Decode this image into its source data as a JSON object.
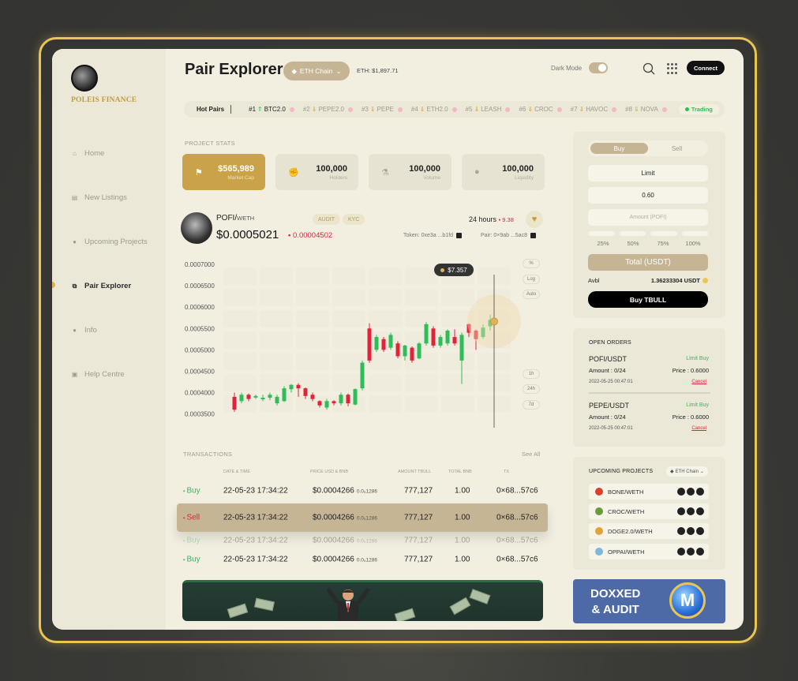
{
  "brand": {
    "name": "POLEIS FINANCE"
  },
  "sidebar": {
    "items": [
      {
        "label": "Home",
        "icon": "home-icon",
        "active": false
      },
      {
        "label": "New Listings",
        "icon": "list-icon",
        "active": false
      },
      {
        "label": "Upcoming Projects",
        "icon": "drop-icon",
        "active": false
      },
      {
        "label": "Pair Explorer",
        "icon": "pair-icon",
        "active": true
      },
      {
        "label": "Info",
        "icon": "info-icon",
        "active": false
      },
      {
        "label": "Help Centre",
        "icon": "help-icon",
        "active": false
      }
    ]
  },
  "header": {
    "title": "Pair Explorer",
    "chain": "ETH Chain",
    "eth_price": "ETH: $1,897.71",
    "dark_mode_label": "Dark Mode",
    "dark_mode_on": true,
    "connect_label": "Connect"
  },
  "hot_pairs": {
    "label": "Hot Pairs",
    "items": [
      {
        "rank": "#1",
        "name": "BTC2.0"
      },
      {
        "rank": "#2",
        "name": "PEPE2.0"
      },
      {
        "rank": "#3",
        "name": "PEPE"
      },
      {
        "rank": "#4",
        "name": "ETH2.0"
      },
      {
        "rank": "#5",
        "name": "LEASH"
      },
      {
        "rank": "#6",
        "name": "CROC"
      },
      {
        "rank": "#7",
        "name": "HAVOC"
      },
      {
        "rank": "#8",
        "name": "NOVA"
      }
    ],
    "status": "Trading"
  },
  "stats": {
    "section_label": "PROJECT STATS",
    "cards": [
      {
        "value": "$565,989",
        "label": "Market Cap",
        "icon": "flag-icon"
      },
      {
        "value": "100,000",
        "label": "Holders",
        "icon": "fist-icon"
      },
      {
        "value": "100,000",
        "label": "Volume",
        "icon": "flask-icon"
      },
      {
        "value": "100,000",
        "label": "Liquidity",
        "icon": "drop-icon"
      }
    ]
  },
  "token": {
    "pair": "POFI/",
    "pair_quote": "WETH",
    "price": "$0.0005021",
    "change": "0.00004502",
    "tags": [
      "AUDIT",
      "KYC"
    ],
    "period": "24 hours",
    "period_change": "9.38",
    "token_addr": "Token: 0xe3a ...b1fd",
    "pair_addr": "Pair: 0×9ab ...5ac8"
  },
  "chart_data": {
    "type": "candlestick",
    "y_ticks": [
      "0.0007000",
      "0.0006500",
      "0.0006000",
      "0.0005500",
      "0.0005000",
      "0.0004500",
      "0.0004000",
      "0.0003500"
    ],
    "ylim": [
      0.00034,
      0.0007
    ],
    "tooltip": "$7.357",
    "buttons_top": [
      "%",
      "Log",
      "Auto"
    ],
    "buttons_bottom": [
      "1h",
      "24h",
      "7d"
    ],
    "candles": [
      [
        0.00039,
        0.00036,
        0.0004,
        0.000355
      ],
      [
        0.00038,
        0.000395,
        0.0004,
        0.000375
      ],
      [
        0.000395,
        0.000385,
        0.000398,
        0.00038
      ],
      [
        0.00039,
        0.000392,
        0.000395,
        0.000385
      ],
      [
        0.000385,
        0.000388,
        0.000395,
        0.00038
      ],
      [
        0.000388,
        0.000395,
        0.0004,
        0.000382
      ],
      [
        0.000375,
        0.00039,
        0.000395,
        0.00037
      ],
      [
        0.00038,
        0.00041,
        0.000415,
        0.000378
      ],
      [
        0.000408,
        0.000418,
        0.00042,
        0.0004
      ],
      [
        0.000418,
        0.00041,
        0.000422,
        0.00039
      ],
      [
        0.00041,
        0.000392,
        0.000412,
        0.000385
      ],
      [
        0.000395,
        0.000385,
        0.0004,
        0.00038
      ],
      [
        0.00038,
        0.00037,
        0.000382,
        0.000365
      ],
      [
        0.000365,
        0.00038,
        0.000385,
        0.00036
      ],
      [
        0.00038,
        0.000375,
        0.000382,
        0.00037
      ],
      [
        0.000375,
        0.000395,
        0.0004,
        0.00037
      ],
      [
        0.000395,
        0.000375,
        0.000398,
        0.000368
      ],
      [
        0.000372,
        0.000408,
        0.00041,
        0.00037
      ],
      [
        0.00041,
        0.00047,
        0.000475,
        0.000405
      ],
      [
        0.00055,
        0.000475,
        0.000562,
        0.00047
      ],
      [
        0.0005,
        0.00053,
        0.000535,
        0.000495
      ],
      [
        0.000525,
        0.0005,
        0.00053,
        0.000495
      ],
      [
        0.000505,
        0.000535,
        0.00054,
        0.0005
      ],
      [
        0.000515,
        0.000485,
        0.00052,
        0.00048
      ],
      [
        0.000485,
        0.00051,
        0.000512,
        0.000475
      ],
      [
        0.000505,
        0.000475,
        0.000508,
        0.00047
      ],
      [
        0.00048,
        0.000515,
        0.000518,
        0.000478
      ],
      [
        0.000515,
        0.00056,
        0.000565,
        0.00051
      ],
      [
        0.00055,
        0.00051,
        0.000555,
        0.000505
      ],
      [
        0.00051,
        0.00053,
        0.000535,
        0.000505
      ],
      [
        0.000515,
        0.000545,
        0.000548,
        0.00051
      ],
      [
        0.00053,
        0.000515,
        0.000548,
        0.00051
      ],
      [
        0.000475,
        0.000535,
        0.00054,
        0.00042
      ],
      [
        0.00056,
        0.00054,
        0.000562,
        0.00053
      ],
      [
        0.000545,
        0.000525,
        0.000548,
        0.0005
      ],
      [
        0.00053,
        0.000552,
        0.00056,
        0.000525
      ],
      [
        0.000555,
        0.00057,
        0.000582,
        0.000545
      ]
    ]
  },
  "transactions": {
    "label": "TRANSACTIONS",
    "see_all": "See All",
    "columns": [
      "DATE & TIME",
      "PRICE USD & BNB",
      "AMOUNT TBULL",
      "TOTAL BNB",
      "TX"
    ],
    "rows": [
      {
        "type": "Buy",
        "date": "22-05-23 17:34:22",
        "price": "$0.0004266",
        "bnb": "0.0₅1286",
        "amount": "777,127",
        "total": "1.00",
        "tx": "0×68...57c6"
      },
      {
        "type": "Sell",
        "date": "22-05-23 17:34:22",
        "price": "$0.0004266",
        "bnb": "0.0₅1286",
        "amount": "777,127",
        "total": "1.00",
        "tx": "0×68...57c6"
      },
      {
        "type": "Buy",
        "date": "22-05-23 17:34:22",
        "price": "$0.0004266",
        "bnb": "0.0₅1286",
        "amount": "777,127",
        "total": "1.00",
        "tx": "0×68...57c6"
      },
      {
        "type": "Buy",
        "date": "22-05-23 17:34:22",
        "price": "$0.0004266",
        "bnb": "0.0₅1286",
        "amount": "777,127",
        "total": "1.00",
        "tx": "0×68...57c6"
      }
    ]
  },
  "trade": {
    "buy_label": "Buy",
    "sell_label": "Sell",
    "order_type": "Limit",
    "price": "0.60",
    "amount_placeholder": "Amount (POFI)",
    "percents": [
      "25%",
      "50%",
      "75%",
      "100%"
    ],
    "total_label": "Total (USDT)",
    "avbl_label": "Avbl",
    "avbl_value": "1.36233304 USDT",
    "submit_label": "Buy TBULL"
  },
  "open_orders": {
    "title": "OPEN ORDERS",
    "orders": [
      {
        "pair": "POFI/USDT",
        "type": "Limit Buy",
        "amount": "Amount :  0/24",
        "price": "Price :  0.6000",
        "date": "2022-05-25 00:47:01",
        "cancel": "Cancel"
      },
      {
        "pair": "PEPE/USDT",
        "type": "Limit Buy",
        "amount": "Amount :  0/24",
        "price": "Price :  0.6000",
        "date": "2022-05-25 00:47:01",
        "cancel": "Cancel"
      }
    ]
  },
  "upcoming": {
    "title": "UPCOMING PROJECTS",
    "chain": "ETH Chain",
    "items": [
      {
        "name": "BONE/WETH",
        "color": "#d9412f"
      },
      {
        "name": "CROC/WETH",
        "color": "#6a9a3a"
      },
      {
        "name": "DOGE2.0/WETH",
        "color": "#e0a33a"
      },
      {
        "name": "OPPAI/WETH",
        "color": "#7fb8d8"
      }
    ]
  },
  "ad": {
    "line1": "DOXXED",
    "line2": "& AUDIT",
    "logo_letter": "M"
  },
  "colors": {
    "accent_gold": "#c9a24a",
    "buy_green": "#2ebd59",
    "sell_red": "#e0233b",
    "tan": "#c6b595"
  }
}
